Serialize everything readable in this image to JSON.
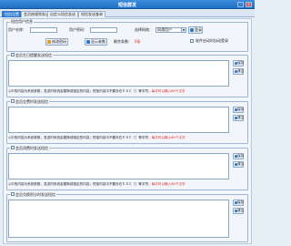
{
  "window": {
    "title": "短信群发",
    "minimize_glyph": "–",
    "close_glyph": "×"
  },
  "tabs": [
    {
      "label": "短信设置"
    },
    {
      "label": "会员按规则发送"
    },
    {
      "label": "自定义短信发送"
    },
    {
      "label": "短信发送查询"
    }
  ],
  "account": {
    "legend": "短信用户信息",
    "username_label": "用户名称：",
    "password_label": "用户密码：",
    "channel_label": "选择网络：",
    "channel_value": "网通用户",
    "login_label": "登录",
    "change_pwd_label": "修改密码",
    "show_params_label": "显示参数",
    "balance_label": "剩余条数：",
    "balance_value": "0条",
    "autostart_label": "软件启动时自动登录"
  },
  "sections": [
    {
      "legend": "会员生日提醒发送短信",
      "notice_black": "◎中的内容为系统参数，发送时系统会替换成相应的内容；短信内容中不要存在ＥＳＣ［］等字符，",
      "notice_red": "每次可以输入80个汉字",
      "save_label": "保存",
      "clear_label": "清空"
    },
    {
      "legend": "会员交费时发送短信",
      "notice_black": "◎中的内容为系统参数，发送时系统会替换成相应的内容；短信内容中不要存在ＥＳＣ［］等字符，",
      "notice_red": "每次可以输入80个汉字",
      "save_label": "保存",
      "clear_label": "清空"
    },
    {
      "legend": "会员消费时发送短信",
      "notice_black": "◎中的内容为系统参数，发送时系统会替换成相应的内容；短信内容中不要存在ＥＳＣ［］等字符，",
      "notice_red": "每次可以输入80个汉字",
      "save_label": "保存",
      "clear_label": "清空"
    },
    {
      "legend": "会员兑换积分时发送短信",
      "save_label": "保存",
      "clear_label": "清空"
    }
  ],
  "colors": {
    "accent": "#2f7ad0",
    "notice_red": "#e21d1d"
  }
}
